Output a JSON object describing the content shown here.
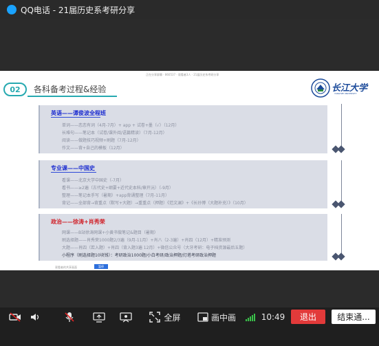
{
  "app": {
    "title": "QQ电话 - 21届历史系考研分享"
  },
  "slide": {
    "top_info": "正在分享屏幕  ·  860537  ·  观看者3人  ·  21届历史系考研分享",
    "section_number": "02",
    "section_title": "各科备考过程&经验",
    "logo": {
      "name": "长江大学",
      "english": "YANGTZE UNIVERSITY"
    },
    "cards": [
      {
        "heading": "英语——谭俊波全程班",
        "lines": [
          "单词——恋恋有词（4月-7月）+ app + 试卷+墨（√）（12月）",
          "长难句——笔记本（试卷/课外阅/语篇精读）（7月-12月）",
          "阅读——做题技巧视频+刷题（7月-12月）",
          "作文——背+自己的模板（12月）"
        ]
      },
      {
        "heading": "专业课——中国史",
        "lines": [
          "看课——北京大学中国史（-7月）",
          "看书——≥2遍（古代史+纲要+近代史本科/章开沅）（-9月）",
          "整理——笔记本手写（暑期）+app背诵整理（7月-11月）",
          "背记——全部背→背重点（默写+大题）→重重点（押题）《范文澜》+《长孙博（大题补充）》（10月）"
        ]
      },
      {
        "heading": "政治——徐涛+肖秀荣",
        "lines": [
          "网课——B站徐涛网课+小黄书做笔记&题目（暑期）",
          "刷选择题——肖秀荣1000题2/3遍（9月-11月）+肖八（2-3遍）+肖四（12月）+精准预测",
          "大题——肖四（若入题）+肖四（背入题3遍 12月）+微信公众号（大牙考研：电子档资源最后五题）",
          "小程序（刷选择题10块钱）：考研政治1000题/小白考研/政治押题/灯塔考研政治押题"
        ]
      }
    ],
    "footer_text": "观看者的共享画面",
    "footer_button": "暂停"
  },
  "toolbar": {
    "fullscreen_label": "全屏",
    "pip_label": "画中画",
    "time": "10:49",
    "exit_label": "退出",
    "end_label": "结束通..."
  },
  "colors": {
    "accent": "#26a9b0",
    "exit": "#e23a3a",
    "heading_blue": "#1c2dd0",
    "heading_red": "#d0222a"
  }
}
